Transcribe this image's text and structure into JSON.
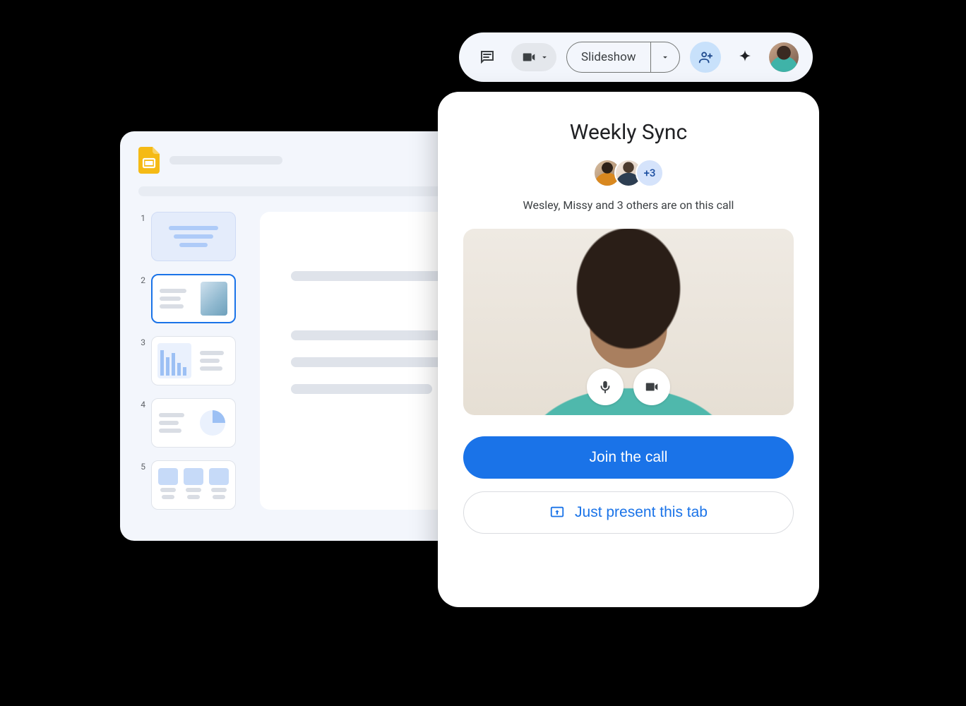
{
  "toolbar": {
    "slideshow_label": "Slideshow"
  },
  "slides": {
    "thumbs": [
      {
        "num": "1"
      },
      {
        "num": "2"
      },
      {
        "num": "3"
      },
      {
        "num": "4"
      },
      {
        "num": "5"
      }
    ]
  },
  "meet": {
    "title": "Weekly Sync",
    "more_count": "+3",
    "subtitle": "Wesley, Missy and 3 others are on this call",
    "join_label": "Join the call",
    "present_label": "Just present this tab"
  }
}
